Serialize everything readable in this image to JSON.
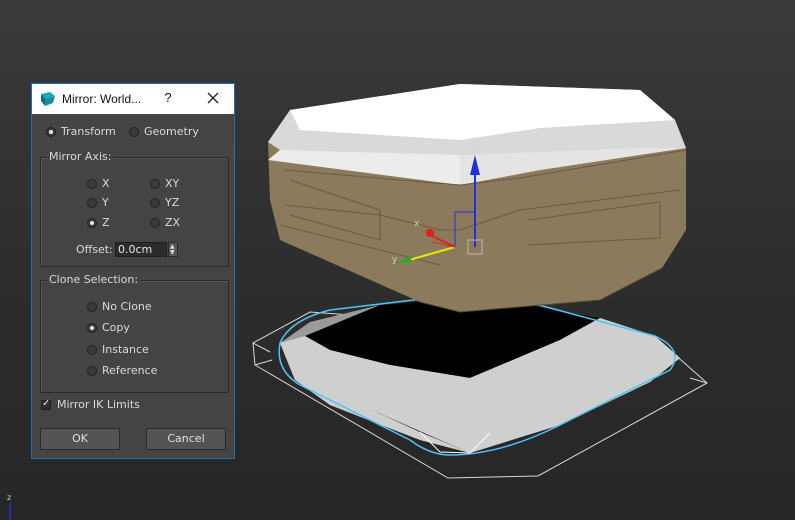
{
  "dialog": {
    "title": "Mirror: World...",
    "help_label": "?",
    "mode_options": [
      {
        "label": "Transform",
        "selected": true
      },
      {
        "label": "Geometry",
        "selected": false
      }
    ],
    "mirror_axis": {
      "title": "Mirror Axis:",
      "options": [
        {
          "label": "X",
          "selected": false
        },
        {
          "label": "Y",
          "selected": false
        },
        {
          "label": "Z",
          "selected": true
        },
        {
          "label": "XY",
          "selected": false
        },
        {
          "label": "YZ",
          "selected": false
        },
        {
          "label": "ZX",
          "selected": false
        }
      ],
      "offset_label": "Offset:",
      "offset_value": "0.0cm"
    },
    "clone_selection": {
      "title": "Clone Selection:",
      "options": [
        {
          "label": "No Clone",
          "selected": false
        },
        {
          "label": "Copy",
          "selected": true
        },
        {
          "label": "Instance",
          "selected": false
        },
        {
          "label": "Reference",
          "selected": false
        }
      ]
    },
    "mirror_ik": {
      "label": "Mirror IK Limits",
      "checked": true
    },
    "ok_label": "OK",
    "cancel_label": "Cancel"
  },
  "viewport": {
    "gizmo_axes": {
      "x": "x",
      "y": "y",
      "z": "z"
    },
    "corner_axis": "z",
    "colors": {
      "x_axis": "#e02020",
      "y_axis": "#e8e800",
      "z_axis": "#2030e0",
      "selection": "#4fc3f7",
      "object_body": "#8c7a5c"
    }
  }
}
